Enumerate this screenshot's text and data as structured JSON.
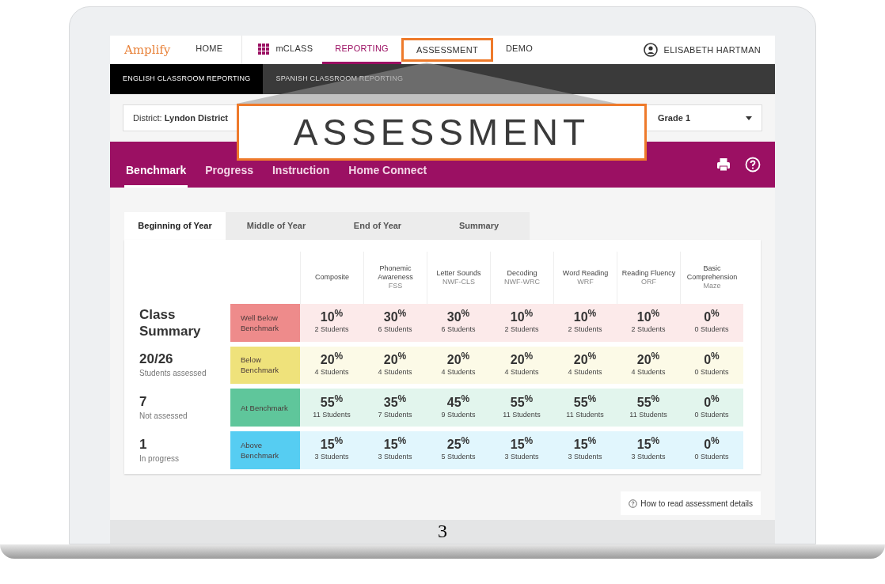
{
  "nav": {
    "logo": "Amplify",
    "items": [
      {
        "label": "HOME",
        "selected": false,
        "kind": "plain"
      },
      {
        "label": "mCLASS",
        "selected": false,
        "kind": "app"
      },
      {
        "label": "REPORTING",
        "selected": true,
        "kind": "plain"
      },
      {
        "label": "ASSESSMENT",
        "selected": false,
        "kind": "highlighted"
      },
      {
        "label": "DEMO",
        "selected": false,
        "kind": "plain"
      }
    ],
    "user": "ELISABETH HARTMAN"
  },
  "subnav": [
    {
      "label": "ENGLISH CLASSROOM REPORTING",
      "selected": true
    },
    {
      "label": "SPANISH CLASSROOM REPORTING",
      "selected": false
    }
  ],
  "filters": {
    "district_label": "District:",
    "district": "Lyndon District",
    "grade": "Grade 1"
  },
  "section_tabs": [
    {
      "label": "Benchmark",
      "selected": true
    },
    {
      "label": "Progress",
      "selected": false
    },
    {
      "label": "Instruction",
      "selected": false
    },
    {
      "label": "Home Connect",
      "selected": false
    }
  ],
  "period_tabs": [
    {
      "label": "Beginning of Year",
      "selected": true
    },
    {
      "label": "Middle of Year",
      "selected": false
    },
    {
      "label": "End of Year",
      "selected": false
    },
    {
      "label": "Summary",
      "selected": false
    }
  ],
  "summary_title": "Class Summary",
  "summary": [
    {
      "value": "20/26",
      "caption": "Students assessed"
    },
    {
      "value": "7",
      "caption": "Not assessed"
    },
    {
      "value": "1",
      "caption": "In progress"
    }
  ],
  "columns": [
    {
      "name": "Composite"
    },
    {
      "name": "Phonemic Awareness",
      "code": "FSS"
    },
    {
      "name": "Letter Sounds",
      "code": "NWF-CLS"
    },
    {
      "name": "Decoding",
      "code": "NWF-WRC"
    },
    {
      "name": "Word Reading",
      "code": "WRF"
    },
    {
      "name": "Reading Fluency",
      "code": "ORF"
    },
    {
      "name": "Basic Comprehension",
      "code": "Maze"
    }
  ],
  "rows": [
    {
      "label": "Well Below Benchmark",
      "color": "#ee8b8b",
      "cells": [
        {
          "pct": "10$^{%}$",
          "students": "2 Students"
        },
        {
          "pct": "30$^{%}$",
          "students": "6 Students"
        },
        {
          "pct": "30$^{%}$",
          "students": "6 Students"
        },
        {
          "pct": "10$^{%}$",
          "students": "2 Students"
        },
        {
          "pct": "10$^{%}$",
          "students": "2 Students"
        },
        {
          "pct": "10$^{%}$",
          "students": "2 Students"
        },
        {
          "pct": "0$^{%}$",
          "students": "0 Students"
        }
      ]
    },
    {
      "label": "Below Benchmark",
      "color": "#efe27b",
      "cells": [
        {
          "pct": "20$^{%}$",
          "students": "4 Students"
        },
        {
          "pct": "20$^{%}$",
          "students": "4 Students"
        },
        {
          "pct": "20$^{%}$",
          "students": "4 Students"
        },
        {
          "pct": "20$^{%}$",
          "students": "4 Students"
        },
        {
          "pct": "20$^{%}$",
          "students": "4 Students"
        },
        {
          "pct": "20$^{%}$",
          "students": "4 Students"
        },
        {
          "pct": "0$^{%}$",
          "students": "0 Students"
        }
      ]
    },
    {
      "label": "At Benchmark",
      "color": "#5fc69b",
      "cells": [
        {
          "pct": "55$^{%}$",
          "students": "11 Students"
        },
        {
          "pct": "35$^{%}$",
          "students": "7 Students"
        },
        {
          "pct": "45$^{%}$",
          "students": "9 Students"
        },
        {
          "pct": "55$^{%}$",
          "students": "11 Students"
        },
        {
          "pct": "55$^{%}$",
          "students": "11 Students"
        },
        {
          "pct": "55$^{%}$",
          "students": "11 Students"
        },
        {
          "pct": "0$^{%}$",
          "students": "0 Students"
        }
      ]
    },
    {
      "label": "Above Benchmark",
      "color": "#56cdf2",
      "cells": [
        {
          "pct": "15$^{%}$",
          "students": "3 Students"
        },
        {
          "pct": "15$^{%}$",
          "students": "3 Students"
        },
        {
          "pct": "25$^{%}$",
          "students": "5 Students"
        },
        {
          "pct": "15$^{%}$",
          "students": "3 Students"
        },
        {
          "pct": "15$^{%}$",
          "students": "3 Students"
        },
        {
          "pct": "15$^{%}$",
          "students": "3 Students"
        },
        {
          "pct": "0$^{%}$",
          "students": "0 Students"
        }
      ]
    }
  ],
  "help_link": "How to read assessment details",
  "callout": "ASSESSMENT",
  "page_number": "3"
}
